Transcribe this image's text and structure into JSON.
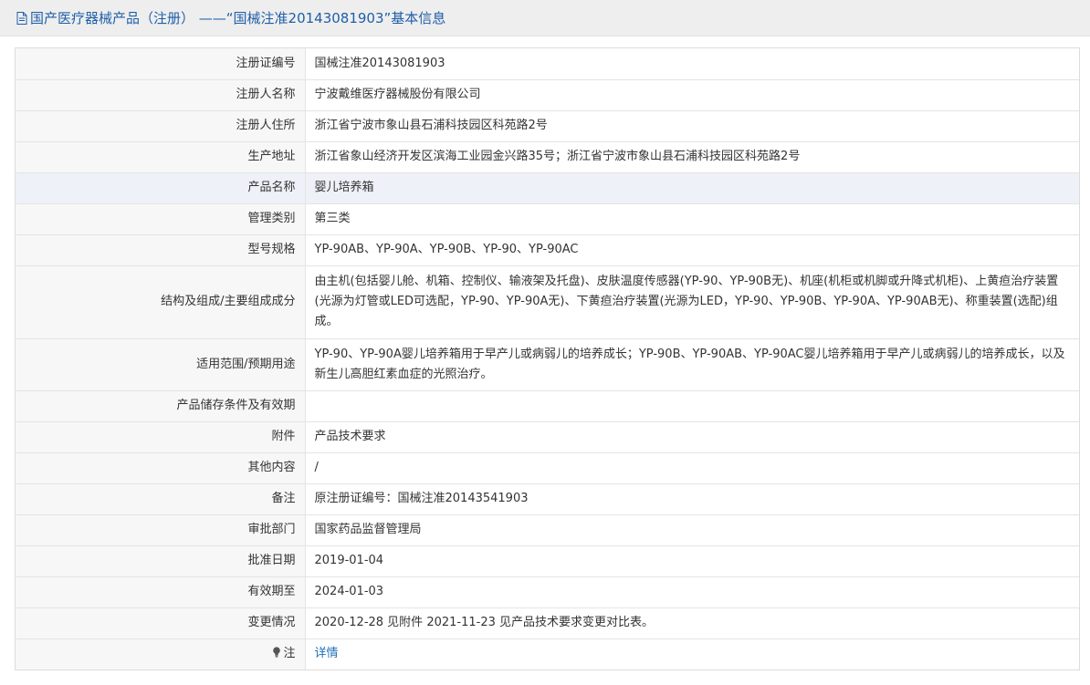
{
  "header": {
    "title": "国产医疗器械产品（注册）  ——“国械注准20143081903”基本信息",
    "icon": "document-icon"
  },
  "rows": [
    {
      "label": "注册证编号",
      "value": "国械注准20143081903"
    },
    {
      "label": "注册人名称",
      "value": "宁波戴维医疗器械股份有限公司"
    },
    {
      "label": "注册人住所",
      "value": "浙江省宁波市象山县石浦科技园区科苑路2号"
    },
    {
      "label": "生产地址",
      "value": "浙江省象山经济开发区滨海工业园金兴路35号；浙江省宁波市象山县石浦科技园区科苑路2号"
    },
    {
      "label": "产品名称",
      "value": "婴儿培养箱"
    },
    {
      "label": "管理类别",
      "value": "第三类"
    },
    {
      "label": "型号规格",
      "value": "YP-90AB、YP-90A、YP-90B、YP-90、YP-90AC"
    },
    {
      "label": "结构及组成/主要组成成分",
      "value": "由主机(包括婴儿舱、机箱、控制仪、输液架及托盘)、皮肤温度传感器(YP-90、YP-90B无)、机座(机柜或机脚或升降式机柜)、上黄疸治疗装置(光源为灯管或LED可选配，YP-90、YP-90A无)、下黄疸治疗装置(光源为LED，YP-90、YP-90B、YP-90A、YP-90AB无)、称重装置(选配)组成。"
    },
    {
      "label": "适用范围/预期用途",
      "value": "YP-90、YP-90A婴儿培养箱用于早产儿或病弱儿的培养成长；YP-90B、YP-90AB、YP-90AC婴儿培养箱用于早产儿或病弱儿的培养成长，以及新生儿高胆红素血症的光照治疗。"
    },
    {
      "label": "产品储存条件及有效期",
      "value": ""
    },
    {
      "label": "附件",
      "value": "产品技术要求"
    },
    {
      "label": "其他内容",
      "value": "/"
    },
    {
      "label": "备注",
      "value": "原注册证编号：国械注准20143541903"
    },
    {
      "label": "审批部门",
      "value": "国家药品监督管理局"
    },
    {
      "label": "批准日期",
      "value": "2019-01-04"
    },
    {
      "label": "有效期至",
      "value": "2024-01-03"
    },
    {
      "label": "变更情况",
      "value": "2020-12-28 见附件 2021-11-23 见产品技术要求变更对比表。"
    }
  ],
  "note": {
    "label": "注",
    "icon": "lightbulb-icon",
    "link_text": "详情"
  },
  "colors": {
    "header_title": "#1f5fa8",
    "link": "#1f6fb7",
    "highlight_row": "#eef1f7"
  }
}
